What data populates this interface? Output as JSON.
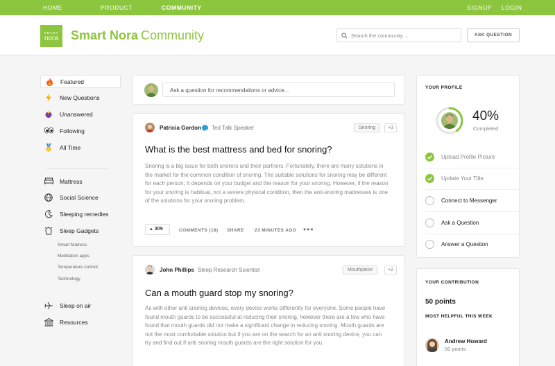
{
  "nav": {
    "home": "HOME",
    "product": "PRODUCT",
    "community": "COMMUNITY",
    "signup": "SIGNUP",
    "login": "LOGIN"
  },
  "header": {
    "logo_top": "SMART",
    "logo_bottom": "nora",
    "brand_bold": "Smart Nora",
    "brand_light": "Community",
    "search_placeholder": "Search the community ...",
    "ask_button": "ASK QUESTION"
  },
  "sidebar": {
    "main": [
      {
        "label": "Featured",
        "icon": "fire-icon"
      },
      {
        "label": "New Questions",
        "icon": "lightning-icon"
      },
      {
        "label": "Unanswered",
        "icon": "sparkles-icon"
      },
      {
        "label": "Following",
        "icon": "eyes-icon"
      },
      {
        "label": "All Time",
        "icon": "medal-icon"
      }
    ],
    "categories": [
      {
        "label": "Mattress",
        "icon": "bed-icon"
      },
      {
        "label": "Social Science",
        "icon": "globe-icon"
      },
      {
        "label": "Sleeping remedies",
        "icon": "moon-icon"
      },
      {
        "label": "Sleep Gadgets",
        "icon": "gadget-icon"
      }
    ],
    "sub": [
      "Smart Matress",
      "Meditation apps",
      "Temperature control",
      "Technology"
    ],
    "extra": [
      {
        "label": "Sleep on air",
        "icon": "plane-icon"
      },
      {
        "label": "Resources",
        "icon": "bank-icon"
      }
    ]
  },
  "composer": {
    "placeholder": "Ask a question for recommendations or advice..."
  },
  "posts": [
    {
      "author": "Patricia Gordon",
      "role": "Ted Talk Speaker",
      "tag": "Snoring",
      "more": "+3",
      "title": "What is the best mattress and bed for snoring?",
      "body": "Snoring is a big issue for both snorers and their partners. Fortunately, there are many solutions in the market for the common condition of snoring. The suitable solutions for snoring may be different for each person; It depends on your budget and the reason for your snoring. However, if the reason for your snoring is habitual, not a severe physical condition, then the anti-snoring mattresses is one of the solutions for your snoring problem.",
      "votes": "309",
      "comments": "COMMENTS (18)",
      "share": "SHARE",
      "time": "23 MINUTES AGO"
    },
    {
      "author": "John Phillips",
      "role": "Sleep Research Scientist",
      "tag": "Mouthpiece",
      "more": "+2",
      "title": "Can a mouth guard stop my snoring?",
      "body": "As with other anti snoring devices, every device works differently for everyone. Some people have found mouth guards to be successful at reducing their snoring, however there are a few who have found that mouth guards did not make a significant change in reducing snoring. Mouth guards are not the most comfortable solution but if you are on the search for an anti snoring device, you can try and find out if anti snoring mouth guards are the right solution for you."
    }
  ],
  "profile": {
    "heading": "YOUR PROFILE",
    "percent": "40%",
    "progress": 0.4,
    "completed": "Completed",
    "tasks": [
      {
        "label": "Upload Profile Picture",
        "done": true
      },
      {
        "label": "Update Your Title",
        "done": true
      },
      {
        "label": "Connect to Messenger",
        "done": false
      },
      {
        "label": "Ask a Question",
        "done": false
      },
      {
        "label": "Answer a Question",
        "done": false
      }
    ]
  },
  "contribution": {
    "heading": "YOUR CONTRIBUTION",
    "points": "50 points",
    "helpful_heading": "MOST HELPFUL THIS WEEK",
    "top_user": "Andrew Howard",
    "top_points": "50 points"
  },
  "colors": {
    "accent": "#8cc63f",
    "verified": "#2d9cdb"
  }
}
